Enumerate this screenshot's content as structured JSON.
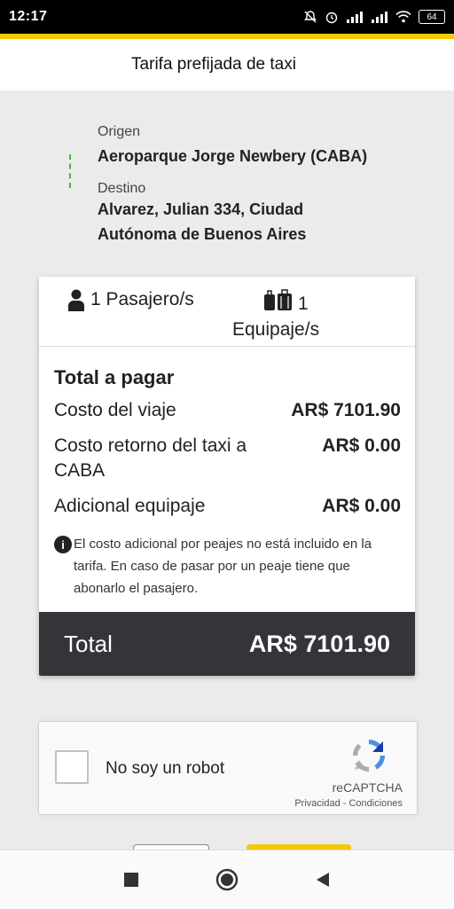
{
  "status_bar": {
    "time": "12:17",
    "battery": "64",
    "icons": [
      "mute-icon",
      "alarm-icon",
      "signal-icon",
      "signal-icon",
      "wifi-icon",
      "battery-icon"
    ]
  },
  "header": {
    "title": "Tarifa prefijada de taxi"
  },
  "route": {
    "origin_label": "Origen",
    "origin_value": "Aeroparque Jorge Newbery (CABA)",
    "destination_label": "Destino",
    "destination_line1": "Alvarez, Julian 334, Ciudad",
    "destination_line2": "Autónoma de Buenos Aires"
  },
  "summary": {
    "passengers": "1 Pasajero/s",
    "luggage_count": "1",
    "luggage_label": "Equipaje/s"
  },
  "costs": {
    "heading": "Total a pagar",
    "rows": [
      {
        "label": "Costo del viaje",
        "value": "AR$ 7101.90"
      },
      {
        "label": "Costo retorno del taxi a CABA",
        "value": "AR$ 0.00"
      },
      {
        "label": "Adicional equipaje",
        "value": "AR$ 0.00"
      }
    ],
    "note": "El costo adicional por peajes no está incluido en la tarifa. En caso de pasar por un peaje tiene que abonarlo el pasajero.",
    "total_label": "Total",
    "total_value": "AR$ 7101.90"
  },
  "captcha": {
    "label": "No soy un robot",
    "brand": "reCAPTCHA",
    "links": "Privacidad - Condiciones"
  },
  "colors": {
    "accent_yellow": "#f4c808",
    "total_bar": "#333539",
    "route_dash": "#4caf50"
  }
}
